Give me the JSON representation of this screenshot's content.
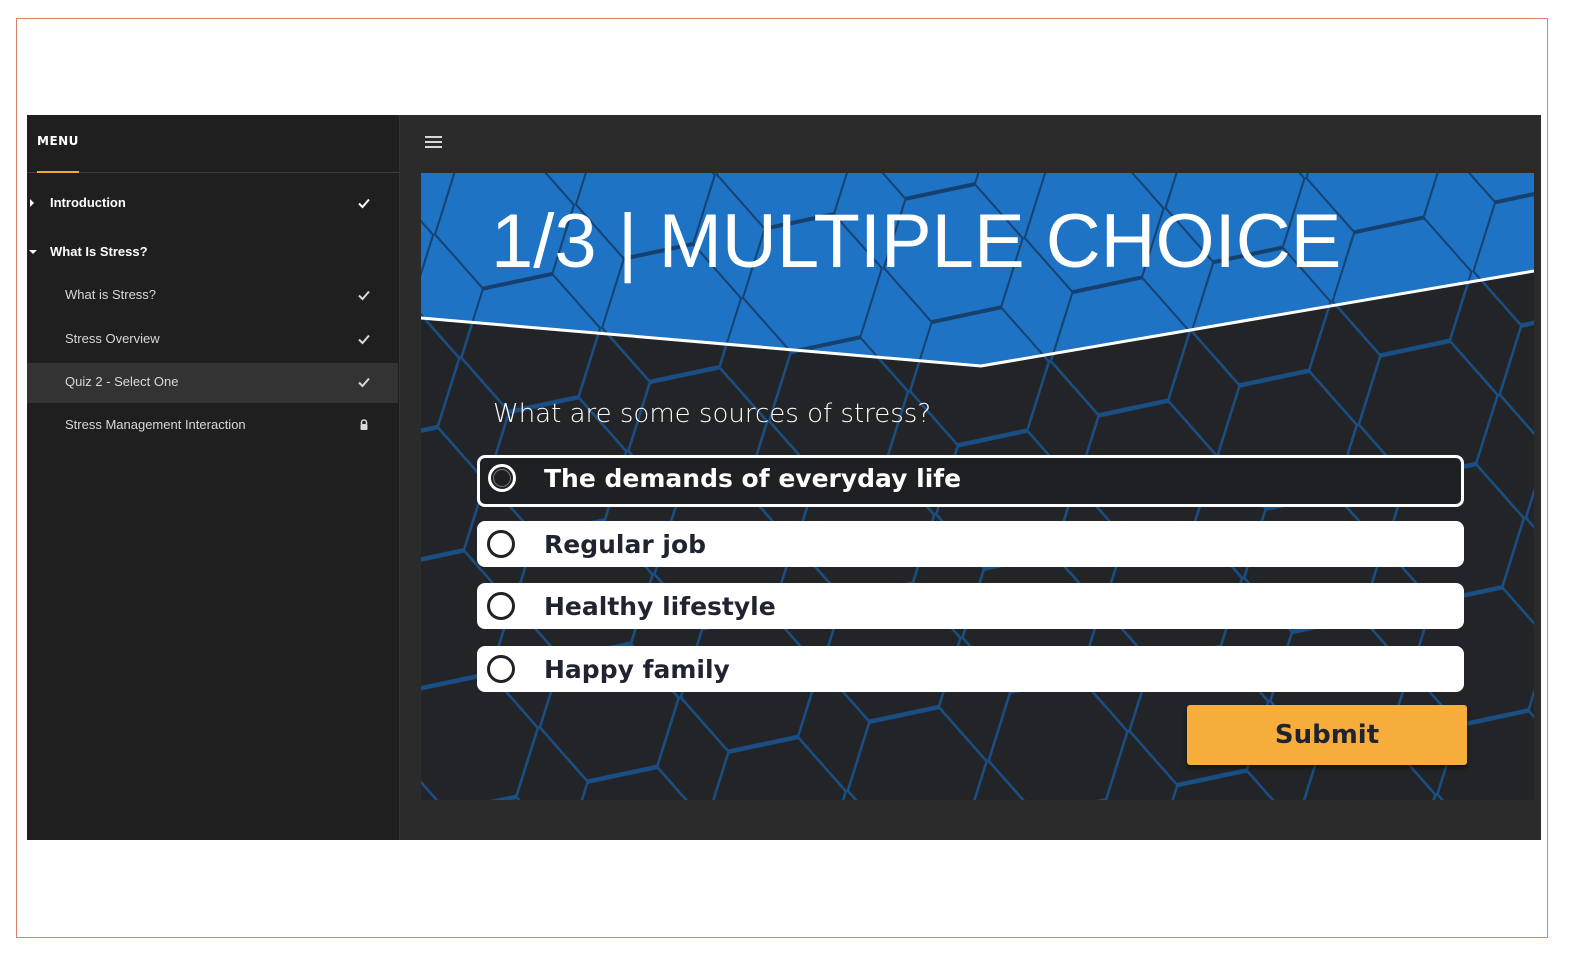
{
  "menu": {
    "title": "MENU",
    "items": [
      {
        "label": "Introduction",
        "type": "section",
        "expanded": false,
        "status": "check-icon"
      },
      {
        "label": "What Is Stress?",
        "type": "section",
        "expanded": true,
        "status": ""
      },
      {
        "label": "What is Stress?",
        "type": "page",
        "status": "check-icon"
      },
      {
        "label": "Stress Overview",
        "type": "page",
        "status": "check-icon"
      },
      {
        "label": "Quiz 2 - Select One",
        "type": "page",
        "status": "check-icon",
        "active": true
      },
      {
        "label": "Stress Management Interaction",
        "type": "page",
        "status": "lock-icon"
      }
    ]
  },
  "slide": {
    "title": "1/3 | MULTIPLE CHOICE",
    "question": "What are some sources of stress?",
    "options": [
      {
        "label": "The demands of everyday life",
        "selected": true
      },
      {
        "label": "Regular job",
        "selected": false
      },
      {
        "label": "Healthy lifestyle",
        "selected": false
      },
      {
        "label": "Happy family",
        "selected": false
      }
    ],
    "submit_label": "Submit"
  },
  "colors": {
    "banner_blue": "#1e73c4",
    "hex_line": "#1a4f86",
    "submit": "#f6ad3c",
    "menu_accent": "#f0a830"
  }
}
